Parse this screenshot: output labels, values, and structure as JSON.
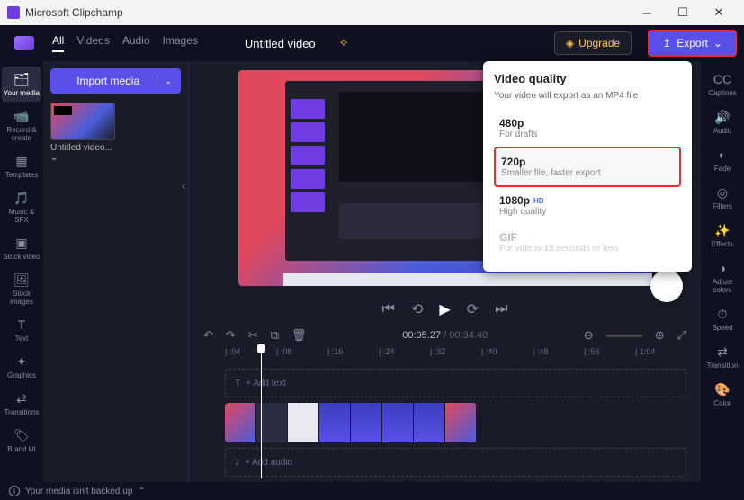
{
  "window": {
    "app_title": "Microsoft Clipchamp"
  },
  "topbar": {
    "tabs": [
      "All",
      "Videos",
      "Audio",
      "Images"
    ],
    "project_title": "Untitled video",
    "upgrade_label": "Upgrade",
    "export_label": "Export"
  },
  "leftnav": [
    {
      "icon": "🗂",
      "label": "Your media"
    },
    {
      "icon": "📹",
      "label": "Record & create"
    },
    {
      "icon": "▦",
      "label": "Templates"
    },
    {
      "icon": "🎵",
      "label": "Music & SFX"
    },
    {
      "icon": "▣",
      "label": "Stock video"
    },
    {
      "icon": "🖼",
      "label": "Stock images"
    },
    {
      "icon": "T",
      "label": "Text"
    },
    {
      "icon": "✦",
      "label": "Graphics"
    },
    {
      "icon": "⇄",
      "label": "Transitions"
    },
    {
      "icon": "🏷",
      "label": "Brand kit"
    }
  ],
  "rightnav": [
    {
      "icon": "CC",
      "label": "Captions"
    },
    {
      "icon": "🔊",
      "label": "Audio"
    },
    {
      "icon": "◐",
      "label": "Fade"
    },
    {
      "icon": "◎",
      "label": "Filters"
    },
    {
      "icon": "✨",
      "label": "Effects"
    },
    {
      "icon": "◑",
      "label": "Adjust colors"
    },
    {
      "icon": "⏱",
      "label": "Speed"
    },
    {
      "icon": "⇄",
      "label": "Transition"
    },
    {
      "icon": "🎨",
      "label": "Color"
    }
  ],
  "media_panel": {
    "import_label": "Import media",
    "clip_name": "Untitled video..."
  },
  "export_popup": {
    "title": "Video quality",
    "subtitle": "Your video will export as an MP4 file",
    "options": [
      {
        "title": "480p",
        "sub": "For drafts"
      },
      {
        "title": "720p",
        "sub": "Smaller file, faster export"
      },
      {
        "title": "1080p",
        "badge": "HD",
        "sub": "High quality"
      },
      {
        "title": "GIF",
        "sub": "For videos 15 seconds or less",
        "disabled": true
      }
    ]
  },
  "timeline": {
    "current_time": "00:05.27",
    "total_time": "00:34.40",
    "ruler": [
      ":04",
      ":08",
      ":16",
      ":24",
      ":32",
      ":40",
      ":48",
      ":56",
      "1:04"
    ],
    "track_text_placeholder": "Add text",
    "track_audio_placeholder": "Add audio"
  },
  "statusbar": {
    "message": "Your media isn't backed up"
  }
}
